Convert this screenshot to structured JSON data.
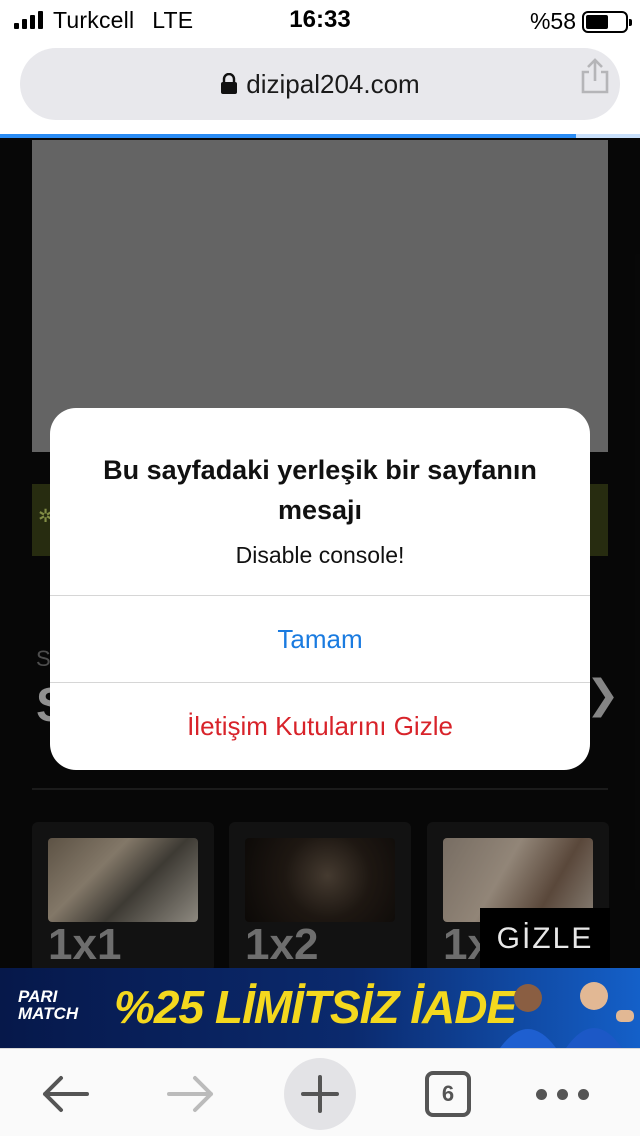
{
  "status_bar": {
    "carrier": "Turkcell",
    "network": "LTE",
    "time": "16:33",
    "battery": "%58",
    "battery_level": 0.58
  },
  "browser": {
    "url": "dizipal204.com",
    "load_progress": 0.9,
    "accent_color": "#2a8cf4"
  },
  "page": {
    "episodes": [
      "1x1",
      "1x2",
      "1x"
    ],
    "hide_button": "GİZLE"
  },
  "ad": {
    "logo_line1": "PARI",
    "logo_line2": "MATCH",
    "headline": "%25 LİMİTSİZ İADE"
  },
  "dialog": {
    "title": "Bu sayfadaki yerleşik bir sayfanın mesajı",
    "message": "Disable console!",
    "ok_label": "Tamam",
    "hide_dialogs_label": "İletişim Kutularını Gizle"
  },
  "toolbar": {
    "tab_count": "6"
  }
}
